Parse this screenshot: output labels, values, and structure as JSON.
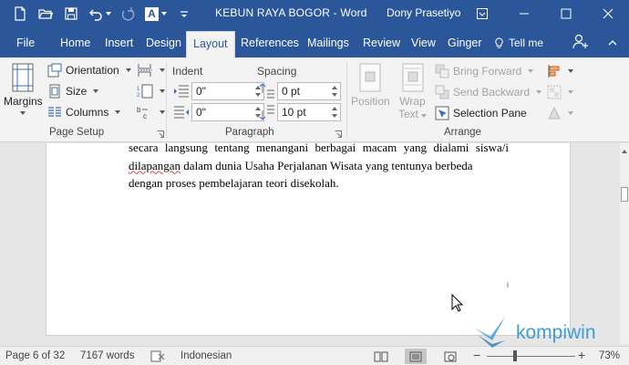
{
  "titlebar": {
    "doc_title": "KEBUN RAYA BOGOR  -  Word",
    "user_name": "Dony Prasetiyo",
    "font_letter": "A"
  },
  "tabs": [
    "File",
    "Home",
    "Insert",
    "Design",
    "Layout",
    "References",
    "Mailings",
    "Review",
    "View",
    "Ginger"
  ],
  "active_tab": "Layout",
  "tell_me": "Tell me",
  "ribbon": {
    "page_setup": {
      "label": "Page Setup",
      "margins": "Margins",
      "orientation": "Orientation",
      "size": "Size",
      "columns": "Columns"
    },
    "paragraph": {
      "label": "Paragraph",
      "indent_label": "Indent",
      "spacing_label": "Spacing",
      "indent_left": "0\"",
      "indent_right": "0\"",
      "spacing_before": "0 pt",
      "spacing_after": "10 pt"
    },
    "arrange": {
      "label": "Arrange",
      "position": "Position",
      "wrap_text_1": "Wrap",
      "wrap_text_2": "Text",
      "bring_forward": "Bring Forward",
      "send_backward": "Send Backward",
      "selection_pane": "Selection Pane"
    }
  },
  "document": {
    "line1": "secara langsung tentang menangani berbagai macam yang dialami siswa/i",
    "line2_err": "dilapangan",
    "line2_rest": " dalam dunia Usaha Perjalanan Wisata yang tentunya berbeda",
    "line3": "dengan proses pembelajaran teori disekolah.",
    "page_mark": "i"
  },
  "status": {
    "page": "Page 6 of 32",
    "words": "7167 words",
    "language": "Indonesian",
    "zoom": "73%",
    "zoom_minus": "−",
    "zoom_plus": "+"
  },
  "watermark": "kompiwin",
  "colors": {
    "word_blue": "#2b579a",
    "ribbon_bg": "#f3f3f3",
    "watermark_blue": "#3e9cd6"
  }
}
